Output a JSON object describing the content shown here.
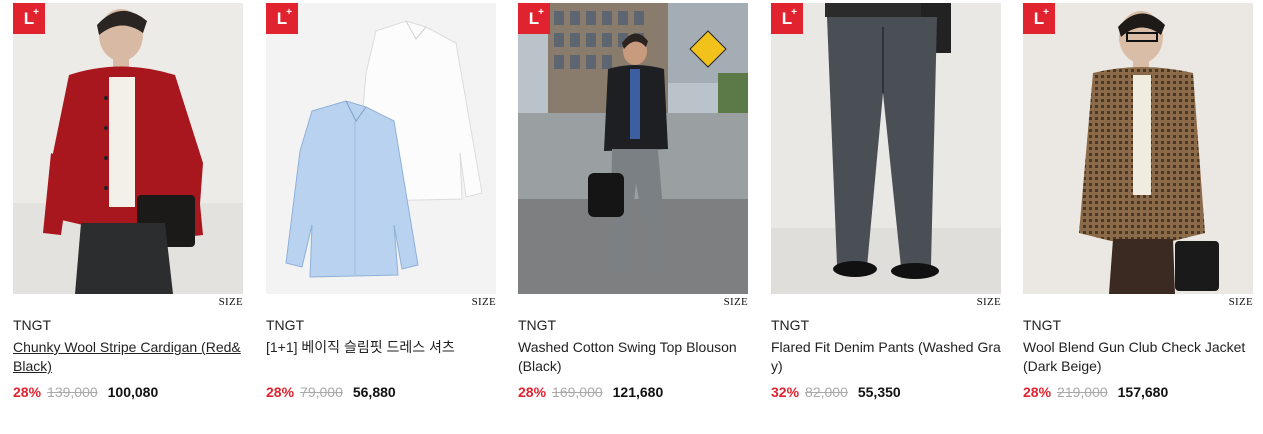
{
  "products": [
    {
      "brand": "TNGT",
      "name": "Chunky Wool Stripe Cardigan (Red&Black)",
      "discount": "28%",
      "original_price": "139,000",
      "sale_price": "100,080",
      "size_label": "SIZE",
      "badge": "L+"
    },
    {
      "brand": "TNGT",
      "name": "[1+1] 베이직 슬림핏 드레스 셔츠",
      "discount": "28%",
      "original_price": "79,000",
      "sale_price": "56,880",
      "size_label": "SIZE",
      "badge": "L+"
    },
    {
      "brand": "TNGT",
      "name": "Washed Cotton Swing Top Blouson (Black)",
      "discount": "28%",
      "original_price": "169,000",
      "sale_price": "121,680",
      "size_label": "SIZE",
      "badge": "L+"
    },
    {
      "brand": "TNGT",
      "name": "Flared Fit Denim Pants (Washed Gray)",
      "discount": "32%",
      "original_price": "82,000",
      "sale_price": "55,350",
      "size_label": "SIZE",
      "badge": "L+"
    },
    {
      "brand": "TNGT",
      "name": "Wool Blend Gun Club Check Jacket (Dark Beige)",
      "discount": "28%",
      "original_price": "219,000",
      "sale_price": "157,680",
      "size_label": "SIZE",
      "badge": "L+"
    }
  ],
  "colors": {
    "accent": "#e1232f",
    "strike": "#aaaaaa",
    "text": "#222222"
  }
}
